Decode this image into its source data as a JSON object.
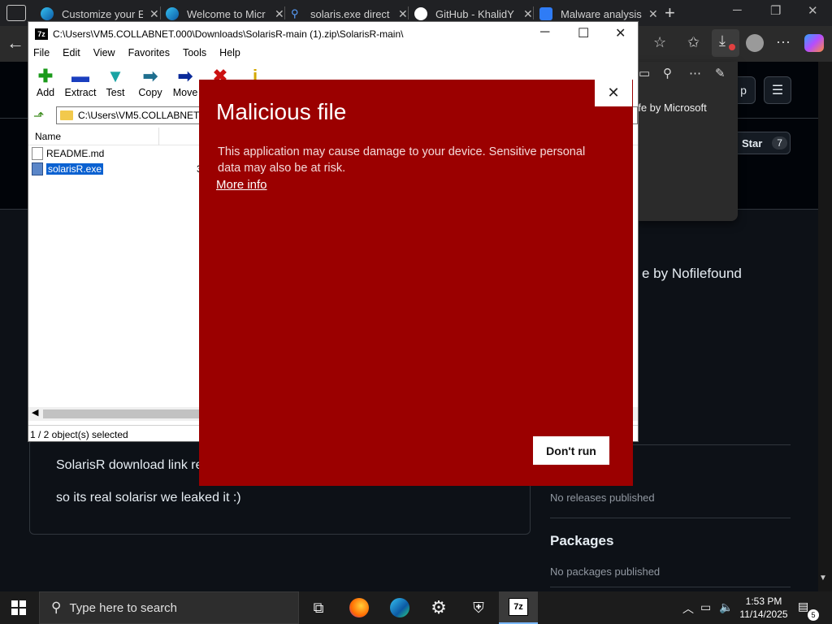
{
  "browser": {
    "tabs": [
      {
        "title": "Customize your E",
        "favicon": "edge-icon"
      },
      {
        "title": "Welcome to Micr",
        "favicon": "edge-icon"
      },
      {
        "title": "solaris.exe direct",
        "favicon": "search-icon"
      },
      {
        "title": "GitHub - KhalidY",
        "favicon": "github-icon"
      },
      {
        "title": "Malware analysis",
        "favicon": "bing-icon"
      }
    ],
    "flyout": {
      "text": "afe by Microsoft",
      "text2": "e"
    }
  },
  "github": {
    "star_label": "Star",
    "star_count": "7",
    "app_label": "p",
    "about_partial": "e by Nofilefound",
    "readme_lines": [
      "SolarisR download link re",
      "so its real solarisr we leaked it :)"
    ],
    "releases_text": "No releases published",
    "packages_heading": "Packages",
    "packages_text": "No packages published"
  },
  "zip": {
    "title_path": "C:\\Users\\VM5.COLLABNET.000\\Downloads\\SolarisR-main (1).zip\\SolarisR-main\\",
    "menu": [
      "File",
      "Edit",
      "View",
      "Favorites",
      "Tools",
      "Help"
    ],
    "tools": [
      {
        "label": "Add",
        "glyph": "✚",
        "color": "#1a9a1a"
      },
      {
        "label": "Extract",
        "glyph": "▬",
        "color": "#1a3fbf"
      },
      {
        "label": "Test",
        "glyph": "▼",
        "color": "#19a3a3"
      },
      {
        "label": "Copy",
        "glyph": "➡",
        "color": "#1f6f8f"
      },
      {
        "label": "Move",
        "glyph": "➡",
        "color": "#0a2a9a"
      }
    ],
    "address": "C:\\Users\\VM5.COLLABNET.000",
    "column_name": "Name",
    "files": [
      {
        "name": "README.md",
        "selected": false
      },
      {
        "name": "solarisR.exe",
        "selected": true
      }
    ],
    "partial_cell": "3",
    "status": "1 / 2 object(s) selected"
  },
  "smartscreen": {
    "title": "Malicious file",
    "body": "This application may cause damage to your device. Sensitive personal data may also be at risk.",
    "link": "More info",
    "button": "Don't run",
    "background": "#9b0000"
  },
  "taskbar": {
    "search_placeholder": "Type here to search",
    "time": "1:53 PM",
    "date": "11/14/2025",
    "notification_count": "5"
  }
}
